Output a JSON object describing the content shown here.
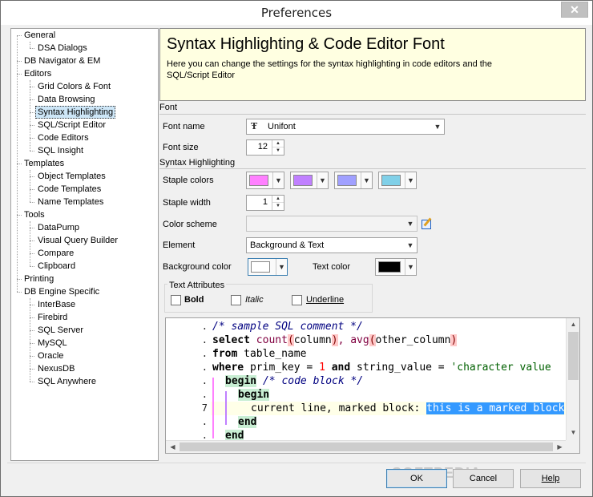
{
  "window": {
    "title": "Preferences",
    "close_label": "✕"
  },
  "tree": {
    "items": [
      {
        "label": "General"
      },
      {
        "label": "DSA Dialogs"
      },
      {
        "label": "DB Navigator & EM"
      },
      {
        "label": "Editors"
      },
      {
        "label": "Grid Colors & Font"
      },
      {
        "label": "Data Browsing"
      },
      {
        "label": "Syntax Highlighting",
        "selected": true
      },
      {
        "label": "SQL/Script Editor"
      },
      {
        "label": "Code Editors"
      },
      {
        "label": "SQL Insight"
      },
      {
        "label": "Templates"
      },
      {
        "label": "Object Templates"
      },
      {
        "label": "Code Templates"
      },
      {
        "label": "Name Templates"
      },
      {
        "label": "Tools"
      },
      {
        "label": "DataPump"
      },
      {
        "label": "Visual Query Builder"
      },
      {
        "label": "Compare"
      },
      {
        "label": "Clipboard"
      },
      {
        "label": "Printing"
      },
      {
        "label": "DB Engine Specific"
      },
      {
        "label": "InterBase"
      },
      {
        "label": "Firebird"
      },
      {
        "label": "SQL Server"
      },
      {
        "label": "MySQL"
      },
      {
        "label": "Oracle"
      },
      {
        "label": "NexusDB"
      },
      {
        "label": "SQL Anywhere"
      }
    ]
  },
  "header": {
    "title": "Syntax Highlighting & Code Editor Font",
    "description": "Here you can change the settings for the syntax highlighting in code editors and the SQL/Script Editor"
  },
  "font": {
    "section_label": "Font",
    "name_label": "Font name",
    "name_value": "Unifont",
    "font_icon": "truetype-font-icon",
    "size_label": "Font size",
    "size_value": "12"
  },
  "syntax": {
    "section_label": "Syntax Highlighting",
    "staple_colors_label": "Staple colors",
    "staple_colors": [
      "#ff80ff",
      "#c080ff",
      "#a0a0ff",
      "#80d0e8"
    ],
    "staple_width_label": "Staple width",
    "staple_width_value": "1",
    "color_scheme_label": "Color scheme",
    "color_scheme_value": "",
    "element_label": "Element",
    "element_value": "Background & Text",
    "background_color_label": "Background color",
    "background_color": "#ffffff",
    "text_color_label": "Text color",
    "text_color": "#000000"
  },
  "text_attributes": {
    "title": "Text Attributes",
    "bold_label": "Bold",
    "italic_label": "Italic",
    "underline_label": "Underline",
    "bold": false,
    "italic": false,
    "underline": false
  },
  "editor": {
    "gutter": [
      ".",
      ".",
      ".",
      ".",
      ".",
      ".",
      "7",
      ".",
      "."
    ],
    "line1_comment": "/* sample SQL comment */",
    "line2_kw": "select",
    "line2_fn1": "count",
    "line2_arg1": "column",
    "line2_fn2": "avg",
    "line2_arg2": "other_column",
    "line3_kw": "from",
    "line3_rest": "table_name",
    "line4_kw": "where",
    "line4_a": "prim_key",
    "line4_num": "1",
    "line4_and": "and",
    "line4_b": "string_value",
    "line4_str": "'character value",
    "line5_kw": "begin",
    "line5_comment": "/* code block */",
    "line6_kw": "begin",
    "line7_text": "current line, marked block:",
    "line7_sel": "this is a marked block",
    "line8_kw": "end",
    "line9_kw": "end"
  },
  "buttons": {
    "ok": "OK",
    "cancel": "Cancel",
    "help": "Help"
  },
  "watermark": "SOFTPEDIA"
}
